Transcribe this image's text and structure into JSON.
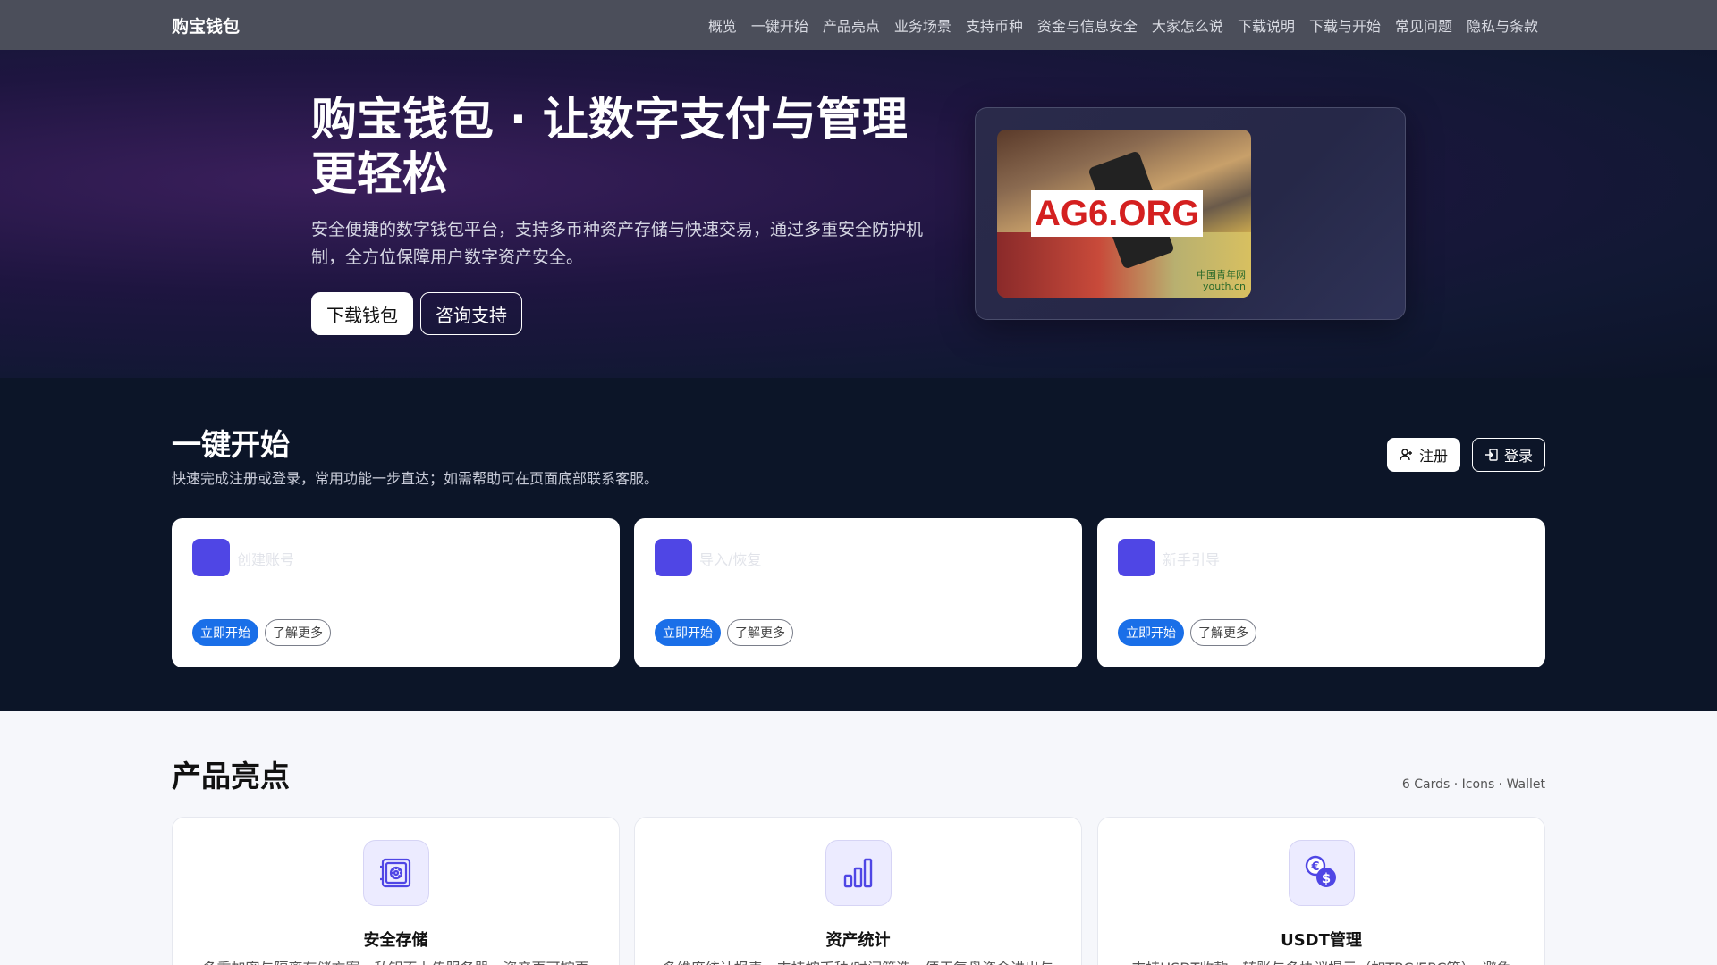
{
  "nav": {
    "brand": "购宝钱包",
    "links": [
      "概览",
      "一键开始",
      "产品亮点",
      "业务场景",
      "支持币种",
      "资金与信息安全",
      "大家怎么说",
      "下载说明",
      "下载与开始",
      "常见问题",
      "隐私与条款"
    ]
  },
  "hero": {
    "title": "购宝钱包 · 让数字支付与管理更轻松",
    "desc": "安全便捷的数字钱包平台，支持多币种资产存储与快速交易，通过多重安全防护机制，全方位保障用户数字资产安全。",
    "btn_download": "下载钱包",
    "btn_support": "咨询支持",
    "image_watermark": "AG6.ORG",
    "image_logo_line1": "中国青年网",
    "image_logo_line2": "youth.cn"
  },
  "quick": {
    "title": "一键开始",
    "subtitle": "快速完成注册或登录，常用功能一步直达；如需帮助可在页面底部联系客服。",
    "register": "注册",
    "login": "登录",
    "cards": [
      {
        "label": "创建账号",
        "go": "立即开始",
        "more": "了解更多"
      },
      {
        "label": "导入/恢复",
        "go": "立即开始",
        "more": "了解更多"
      },
      {
        "label": "新手引导",
        "go": "立即开始",
        "more": "了解更多"
      }
    ]
  },
  "features": {
    "title": "产品亮点",
    "meta": "6 Cards · Icons · Wallet",
    "cards": [
      {
        "icon": "safe-icon",
        "name": "安全存储",
        "desc": "多重加密与隔离存储方案，私钥不上传服务器，资产更可控更"
      },
      {
        "icon": "bar-chart-icon",
        "name": "资产统计",
        "desc": "多维度统计报表，支持按币种/时间筛选，便于复盘资金进出与"
      },
      {
        "icon": "currency-exchange-icon",
        "name": "USDT管理",
        "desc": "支持USDT收款、转账与多协议提示（如TRC/ERC等），避免"
      }
    ]
  },
  "colors": {
    "accent": "#4f46e5",
    "primary_button": "#1a6fe8",
    "nav_bg": "#4b4e5a",
    "dark_bg": "#0c1528"
  }
}
